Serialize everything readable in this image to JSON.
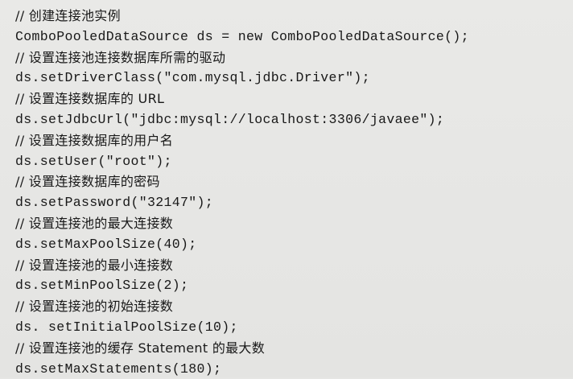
{
  "listing": {
    "lines": [
      {
        "kind": "comment",
        "text": "// 创建连接池实例"
      },
      {
        "kind": "code",
        "text": "ComboPooledDataSource ds = new ComboPooledDataSource();"
      },
      {
        "kind": "comment",
        "text": "// 设置连接池连接数据库所需的驱动"
      },
      {
        "kind": "code",
        "text": "ds.setDriverClass(\"com.mysql.jdbc.Driver\");"
      },
      {
        "kind": "comment",
        "text": "// 设置连接数据库的 URL"
      },
      {
        "kind": "code",
        "text": "ds.setJdbcUrl(\"jdbc:mysql://localhost:3306/javaee\");"
      },
      {
        "kind": "comment",
        "text": "// 设置连接数据库的用户名"
      },
      {
        "kind": "code",
        "text": "ds.setUser(\"root\");"
      },
      {
        "kind": "comment",
        "text": "// 设置连接数据库的密码"
      },
      {
        "kind": "code",
        "text": "ds.setPassword(\"32147\");"
      },
      {
        "kind": "comment",
        "text": "// 设置连接池的最大连接数"
      },
      {
        "kind": "code",
        "text": "ds.setMaxPoolSize(40);"
      },
      {
        "kind": "comment",
        "text": "// 设置连接池的最小连接数"
      },
      {
        "kind": "code",
        "text": "ds.setMinPoolSize(2);"
      },
      {
        "kind": "comment",
        "text": "// 设置连接池的初始连接数"
      },
      {
        "kind": "code",
        "text": "ds. setInitialPoolSize(10);"
      },
      {
        "kind": "comment",
        "text": "// 设置连接池的缓存 Statement 的最大数"
      },
      {
        "kind": "code",
        "text": "ds.setMaxStatements(180);"
      }
    ]
  }
}
